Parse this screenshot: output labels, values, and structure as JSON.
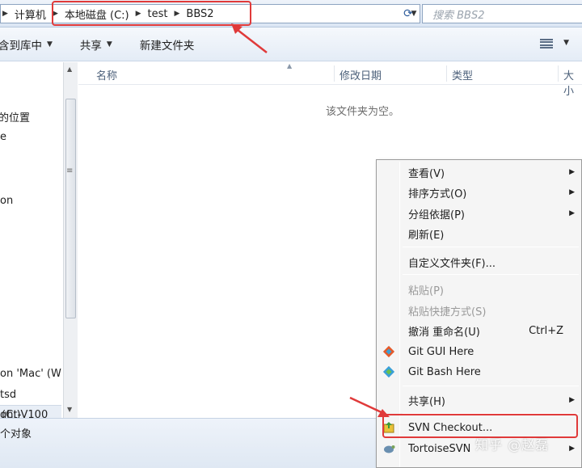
{
  "address_bar": {
    "breadcrumbs": [
      "计算机",
      "本地磁盘 (C:)",
      "test",
      "BBS2"
    ],
    "search_placeholder": "搜索 BBS2"
  },
  "toolbar": {
    "include_library": "含到库中",
    "share": "共享",
    "new_folder": "新建文件夹"
  },
  "navigation": {
    "items": [
      "的位置",
      "e",
      "on"
    ],
    "drive": "(C:)",
    "lower_items": [
      "on 'Mac' (W",
      "tsd",
      "ght-V100"
    ]
  },
  "columns": [
    "名称",
    "修改日期",
    "类型",
    "大小"
  ],
  "empty_message": "该文件夹为空。",
  "status": {
    "text": "个对象"
  },
  "context_menu": {
    "items": [
      {
        "label": "查看(V)"
      },
      {
        "label": "排序方式(O)"
      },
      {
        "label": "分组依据(P)"
      },
      {
        "label": "刷新(E)"
      },
      {
        "label": "自定义文件夹(F)..."
      },
      {
        "label": "粘贴(P)"
      },
      {
        "label": "粘贴快捷方式(S)"
      },
      {
        "label": "撤消 重命名(U)",
        "accelerator": "Ctrl+Z"
      },
      {
        "label": "Git GUI Here"
      },
      {
        "label": "Git Bash Here"
      },
      {
        "label": "共享(H)"
      },
      {
        "label": "SVN Checkout..."
      },
      {
        "label": "TortoiseSVN"
      }
    ]
  },
  "watermark": "知乎 @赵磊",
  "colors": {
    "highlight": "#e03a3a",
    "menu_bg": "#f5f5f5",
    "toolbar_bg": "#e4ecf6"
  }
}
